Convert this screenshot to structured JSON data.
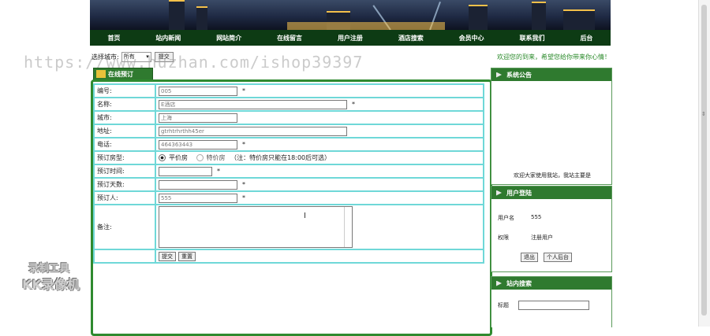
{
  "nav": [
    "首页",
    "站内新闻",
    "网站简介",
    "在线留言",
    "用户注册",
    "酒店搜索",
    "会员中心",
    "联系我们",
    "后台"
  ],
  "city_filter": {
    "label": "选择城市:",
    "value": "所有",
    "button": "提交"
  },
  "welcome": "欢迎您的到来，希望您给你带来你心情！",
  "watermark": "https://www.huzhan.com/ishop39397",
  "tab": "在线预订",
  "form": {
    "rows": [
      {
        "label": "编号:",
        "value": "005",
        "required": "*"
      },
      {
        "label": "名称:",
        "value": "E酒店",
        "required": "*"
      },
      {
        "label": "城市:",
        "value": "上海",
        "required": ""
      },
      {
        "label": "地址:",
        "value": "gtrhtrhrthh45er",
        "required": ""
      },
      {
        "label": "电话:",
        "value": "464363443",
        "required": "*"
      }
    ],
    "room_type": {
      "label": "预订房型:",
      "option1": "平价房",
      "option2": "特价房",
      "note": "（注：特价房只能在18:00后可选）"
    },
    "time": {
      "label": "预订时间:",
      "value": "",
      "required": "*"
    },
    "days": {
      "label": "预订天数:",
      "value": "",
      "required": "*"
    },
    "person": {
      "label": "预订人:",
      "value": "555",
      "required": "*"
    },
    "remark": {
      "label": "备注:",
      "value": ""
    },
    "submit": "提交",
    "reset": "重置"
  },
  "announce": {
    "title": "系统公告",
    "text": "欢迎大家使用我站，我站主要是"
  },
  "login": {
    "title": "用户登陆",
    "user_label": "用户名",
    "user_value": "555",
    "role_label": "权限",
    "role_value": "注册用户",
    "logout": "退出",
    "center": "个人后台"
  },
  "search": {
    "title": "站内搜索",
    "label": "标题"
  },
  "stamp": {
    "line1": "录制工具",
    "line2": "KK录像机"
  }
}
